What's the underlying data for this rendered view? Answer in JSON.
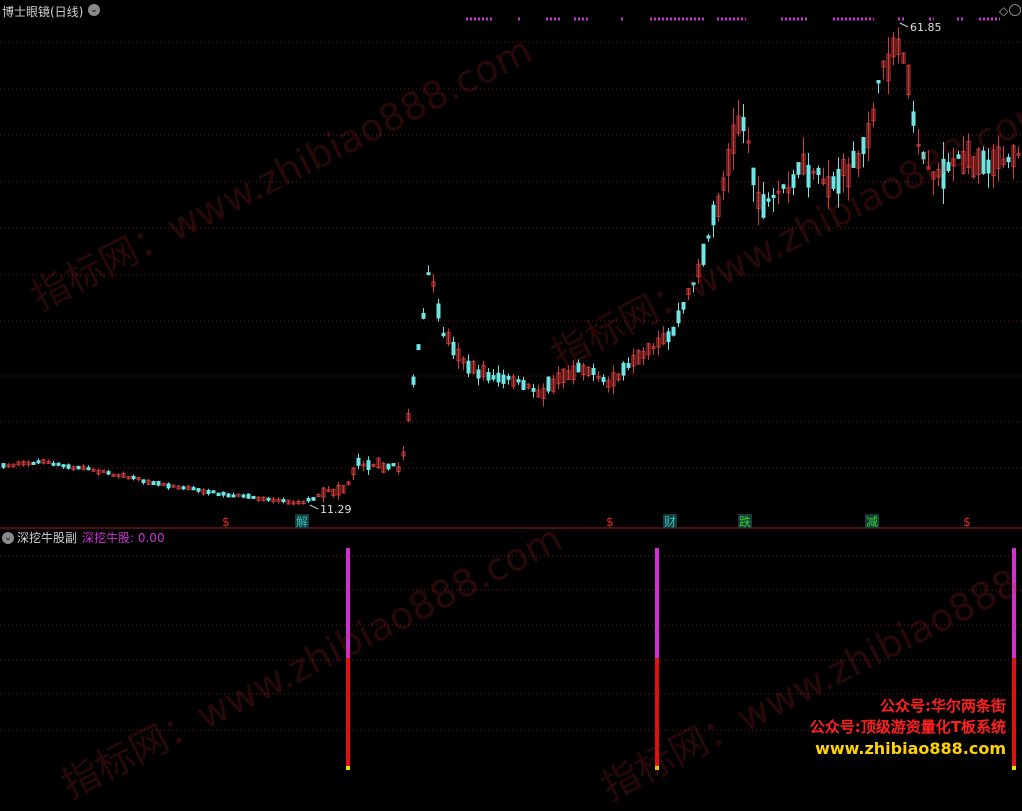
{
  "main_panel": {
    "title": "博士眼镜(日线)",
    "high_label": "61.85",
    "low_label": "11.29",
    "signals": [
      {
        "text": "$",
        "color": "#e03030"
      },
      {
        "text": "解",
        "color": "#30c0c0"
      },
      {
        "text": "$",
        "color": "#e03030"
      },
      {
        "text": "财",
        "color": "#30c0c0"
      },
      {
        "text": "跌",
        "color": "#30d030"
      },
      {
        "text": "减",
        "color": "#30d030"
      },
      {
        "text": "$",
        "color": "#e03030"
      }
    ]
  },
  "sub_panel": {
    "title": "深挖牛股副",
    "indicator": "深挖牛股: 0.00"
  },
  "watermark": "指标网：www.zhibiao888.com",
  "promo": {
    "line1": "公众号:华尔两条街",
    "line2": "公众号:顶级游资量化T板系统",
    "line3": "www.zhibiao888.com"
  },
  "colors": {
    "up": "#d03a3a",
    "down": "#6ee6e6",
    "grid": "#7a1414",
    "magenta": "#d030d0",
    "bar_red": "#e01010",
    "bar_yellow": "#e8e000"
  }
}
